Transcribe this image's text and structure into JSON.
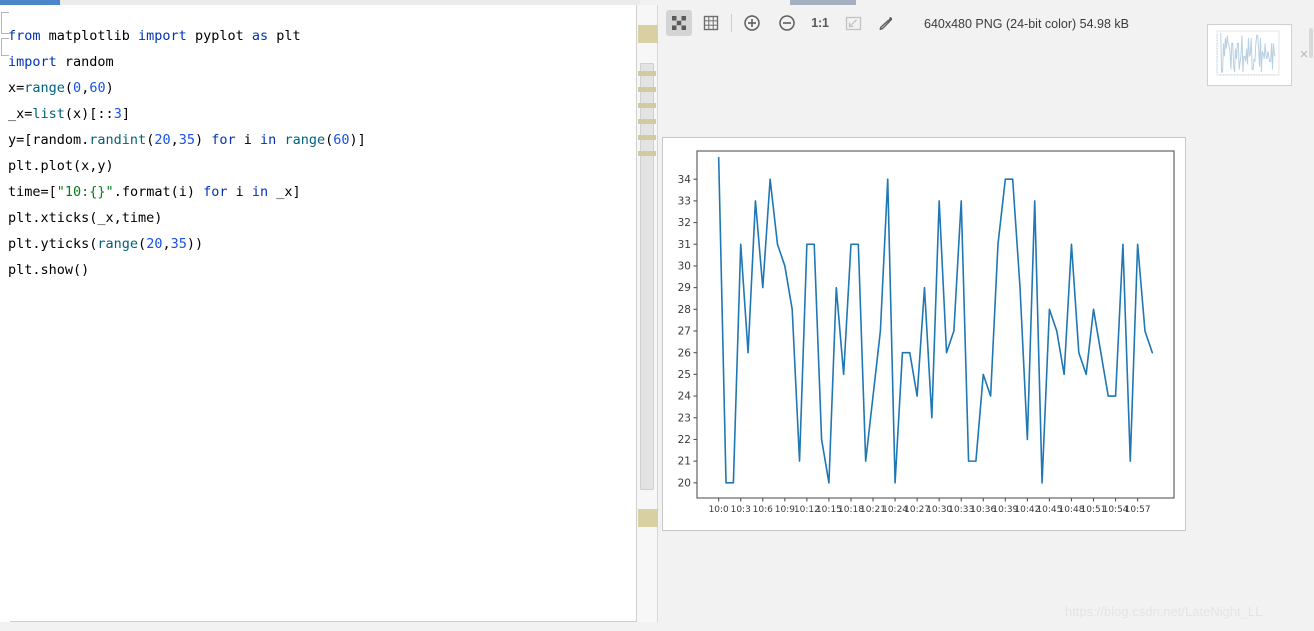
{
  "editor": {
    "lines": [
      [
        {
          "t": "from ",
          "c": "k"
        },
        {
          "t": "matplotlib ",
          "c": "p"
        },
        {
          "t": "import ",
          "c": "k"
        },
        {
          "t": "pyplot ",
          "c": "p"
        },
        {
          "t": "as ",
          "c": "k"
        },
        {
          "t": "plt",
          "c": "p"
        }
      ],
      [
        {
          "t": "import ",
          "c": "k"
        },
        {
          "t": "random",
          "c": "p"
        }
      ],
      [
        {
          "t": "x=",
          "c": "p"
        },
        {
          "t": "range",
          "c": "f"
        },
        {
          "t": "(",
          "c": "p"
        },
        {
          "t": "0",
          "c": "n"
        },
        {
          "t": ",",
          "c": "p"
        },
        {
          "t": "60",
          "c": "n"
        },
        {
          "t": ")",
          "c": "p"
        }
      ],
      [
        {
          "t": "_x=",
          "c": "p"
        },
        {
          "t": "list",
          "c": "f"
        },
        {
          "t": "(x)[::",
          "c": "p"
        },
        {
          "t": "3",
          "c": "n"
        },
        {
          "t": "]",
          "c": "p"
        }
      ],
      [
        {
          "t": "y=[random.",
          "c": "p"
        },
        {
          "t": "randint",
          "c": "f"
        },
        {
          "t": "(",
          "c": "p"
        },
        {
          "t": "20",
          "c": "n"
        },
        {
          "t": ",",
          "c": "p"
        },
        {
          "t": "35",
          "c": "n"
        },
        {
          "t": ") ",
          "c": "p"
        },
        {
          "t": "for ",
          "c": "k"
        },
        {
          "t": "i ",
          "c": "p"
        },
        {
          "t": "in ",
          "c": "k"
        },
        {
          "t": "range",
          "c": "f"
        },
        {
          "t": "(",
          "c": "p"
        },
        {
          "t": "60",
          "c": "n"
        },
        {
          "t": ")]",
          "c": "p"
        }
      ],
      [
        {
          "t": "plt.plot(x,y)",
          "c": "p"
        }
      ],
      [
        {
          "t": "time=[",
          "c": "p"
        },
        {
          "t": "\"10:{}\"",
          "c": "s"
        },
        {
          "t": ".format(i) ",
          "c": "p"
        },
        {
          "t": "for ",
          "c": "k"
        },
        {
          "t": "i ",
          "c": "p"
        },
        {
          "t": "in ",
          "c": "k"
        },
        {
          "t": "_x]",
          "c": "p"
        }
      ],
      [
        {
          "t": "plt.xticks(_x,time)",
          "c": "p"
        }
      ],
      [
        {
          "t": "plt.yticks(",
          "c": "p"
        },
        {
          "t": "range",
          "c": "f"
        },
        {
          "t": "(",
          "c": "p"
        },
        {
          "t": "20",
          "c": "n"
        },
        {
          "t": ",",
          "c": "p"
        },
        {
          "t": "35",
          "c": "n"
        },
        {
          "t": "))",
          "c": "p"
        }
      ],
      [
        {
          "t": "plt.show()",
          "c": "p"
        }
      ]
    ],
    "full_text": "from matplotlib import pyplot as plt\nimport random\nx=range(0,60)\n_x=list(x)[::3]\ny=[random.randint(20,35) for i in range(60)]\nplt.plot(x,y)\ntime=[\"10:{}\".format(i) for i in _x]\nplt.xticks(_x,time)\nplt.yticks(range(20,35))\nplt.show()"
  },
  "viewer": {
    "toolbar": {
      "buttons": [
        {
          "name": "transparency-grid-icon",
          "label": "",
          "active": true
        },
        {
          "name": "grid-icon",
          "label": "",
          "active": false
        },
        {
          "name": "zoom-in-icon",
          "label": "",
          "active": false
        },
        {
          "name": "zoom-out-icon",
          "label": "",
          "active": false
        },
        {
          "name": "actual-size-icon",
          "label": "1:1",
          "active": false
        },
        {
          "name": "fit-to-window-icon",
          "label": "",
          "active": false
        },
        {
          "name": "color-picker-icon",
          "label": "",
          "active": false
        }
      ],
      "actual_size_label": "1:1",
      "info": "640x480 PNG (24-bit color) 54.98 kB"
    },
    "thumbnail": {
      "close_label": "×"
    }
  },
  "watermark": {
    "text": "https://blog.csdn.net/LateNight_LL"
  },
  "colors": {
    "line": "#1f77b4",
    "editor_tab_accent": "#4a86c8",
    "viewer_tab_accent": "#a4b0c0",
    "stripe_marker": "#d3cb9c",
    "keyword": "#0033b3",
    "number": "#1750eb",
    "string": "#067d17"
  },
  "chart_data": {
    "type": "line",
    "title": "",
    "xlabel": "",
    "ylabel": "",
    "ylim": [
      19.3,
      35.3
    ],
    "xlim": [
      -2.95,
      61.95
    ],
    "grid": false,
    "legend": null,
    "xticks": [
      0,
      3,
      6,
      9,
      12,
      15,
      18,
      21,
      24,
      27,
      30,
      33,
      36,
      39,
      42,
      45,
      48,
      51,
      54,
      57
    ],
    "xticklabels": [
      "10:0",
      "10:3",
      "10:6",
      "10:9",
      "10:12",
      "10:15",
      "10:18",
      "10:21",
      "10:24",
      "10:27",
      "10:30",
      "10:33",
      "10:36",
      "10:39",
      "10:42",
      "10:45",
      "10:48",
      "10:51",
      "10:54",
      "10:57"
    ],
    "yticks": [
      20,
      21,
      22,
      23,
      24,
      25,
      26,
      27,
      28,
      29,
      30,
      31,
      32,
      33,
      34
    ],
    "x": [
      0,
      1,
      2,
      3,
      4,
      5,
      6,
      7,
      8,
      9,
      10,
      11,
      12,
      13,
      14,
      15,
      16,
      17,
      18,
      19,
      20,
      21,
      22,
      23,
      24,
      25,
      26,
      27,
      28,
      29,
      30,
      31,
      32,
      33,
      34,
      35,
      36,
      37,
      38,
      39,
      40,
      41,
      42,
      43,
      44,
      45,
      46,
      47,
      48,
      49,
      50,
      51,
      52,
      53,
      54,
      55,
      56,
      57,
      58,
      59
    ],
    "values": [
      35,
      20,
      20,
      31,
      26,
      33,
      29,
      34,
      31,
      30,
      28,
      21,
      31,
      31,
      22,
      20,
      29,
      25,
      31,
      31,
      21,
      24,
      27,
      34,
      20,
      26,
      26,
      24,
      29,
      23,
      33,
      26,
      27,
      33,
      21,
      21,
      25,
      24,
      31,
      34,
      34,
      29,
      22,
      33,
      20,
      28,
      27,
      25,
      31,
      26,
      25,
      28,
      26,
      24,
      24,
      31,
      21,
      31,
      27,
      26
    ]
  }
}
